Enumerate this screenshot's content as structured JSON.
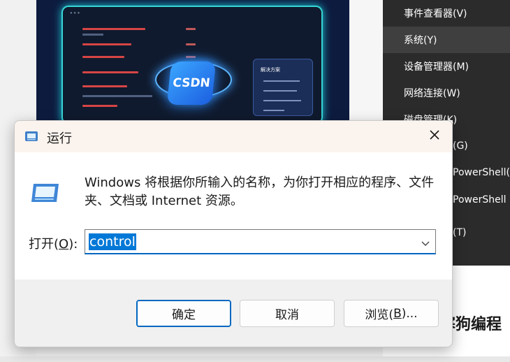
{
  "background": {
    "banner": {
      "logo_text": "CSDN",
      "card_title": "解决方案"
    },
    "context_menu": {
      "items": [
        {
          "label": "事件查看器(V)"
        },
        {
          "label": "系统(Y)"
        },
        {
          "label": "设备管理器(M)"
        },
        {
          "label": "网络连接(W)"
        },
        {
          "label": "磁盘管理(K)"
        },
        {
          "label": "(G)"
        },
        {
          "label": "PowerShell(I)"
        },
        {
          "label": "PowerShell (管"
        },
        {
          "label": "(T)"
        }
      ],
      "highlighted_index": 1
    },
    "bottom_text": "寒狗编程"
  },
  "dialog": {
    "title": "运行",
    "description": "Windows 将根据你所输入的名称，为你打开相应的程序、文件夹、文档或 Internet 资源。",
    "open_label_prefix": "打开(",
    "open_label_key": "O",
    "open_label_suffix": "):",
    "input_value": "control",
    "buttons": {
      "ok": "确定",
      "cancel": "取消",
      "browse_prefix": "浏览(",
      "browse_key": "B",
      "browse_suffix": ")..."
    },
    "accent_color": "#0078d7"
  }
}
